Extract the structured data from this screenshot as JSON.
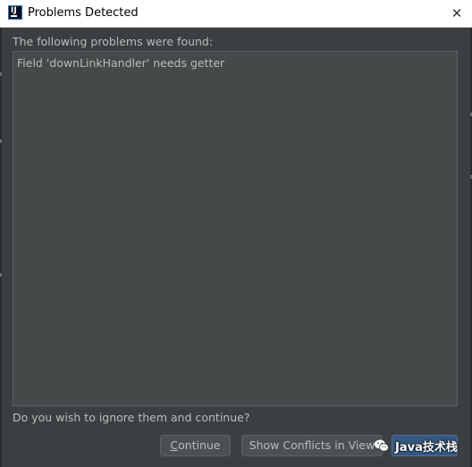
{
  "window": {
    "title": "Problems Detected",
    "close_label": "✕"
  },
  "dialog": {
    "header": "The following problems were found:",
    "problems": [
      "Field 'downLinkHandler' needs getter"
    ],
    "question": "Do you wish to ignore them and continue?"
  },
  "buttons": {
    "continue_first": "C",
    "continue_rest": "ontinue",
    "show_conflicts": "Show Conflicts in View",
    "cancel": ""
  },
  "watermark": {
    "text": "Java技术栈",
    "icon": "wechat-icon"
  },
  "colors": {
    "background": "#3c3f41",
    "text": "#bbbbbb",
    "list_background": "#45494a",
    "default_button": "#365880"
  }
}
